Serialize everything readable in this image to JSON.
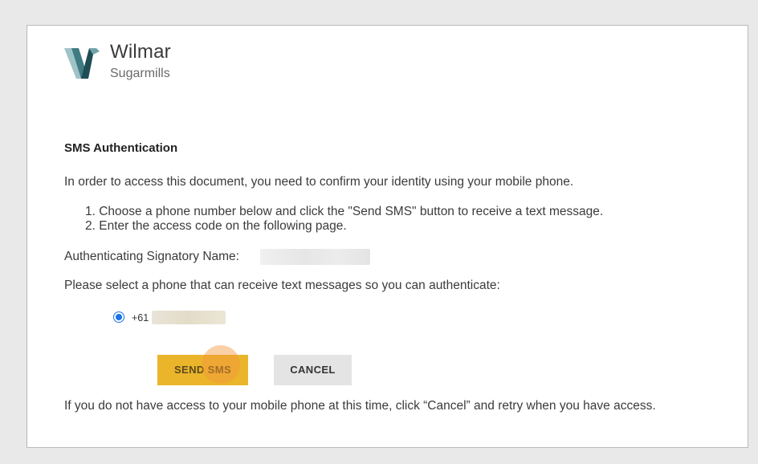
{
  "brand": {
    "name": "Wilmar",
    "subtitle": "Sugarmills",
    "logo_icon": "wilmar-w-logo-icon",
    "logo_color": "#2f5f66"
  },
  "auth": {
    "heading": "SMS Authentication",
    "intro": "In order to access this document, you need to confirm your identity using your mobile phone.",
    "steps": [
      "1. Choose a phone number below and click the \"Send SMS\" button to receive a text message.",
      "2. Enter the access code on the following page."
    ],
    "signatory_label": "Authenticating Signatory Name:",
    "select_prompt": "Please select a phone that can receive text messages so you can authenticate:",
    "phone_option": {
      "prefix": "+61",
      "selected": true
    },
    "buttons": {
      "send": "SEND SMS",
      "cancel": "CANCEL"
    },
    "footer_note": "If you do not have access to your mobile phone at this time, click “Cancel” and retry when you have access."
  },
  "colors": {
    "send_button": "#eab52b",
    "cancel_button": "#e4e4e4",
    "radio_accent": "#1a73e8",
    "page_background": "#e9e9e9"
  }
}
